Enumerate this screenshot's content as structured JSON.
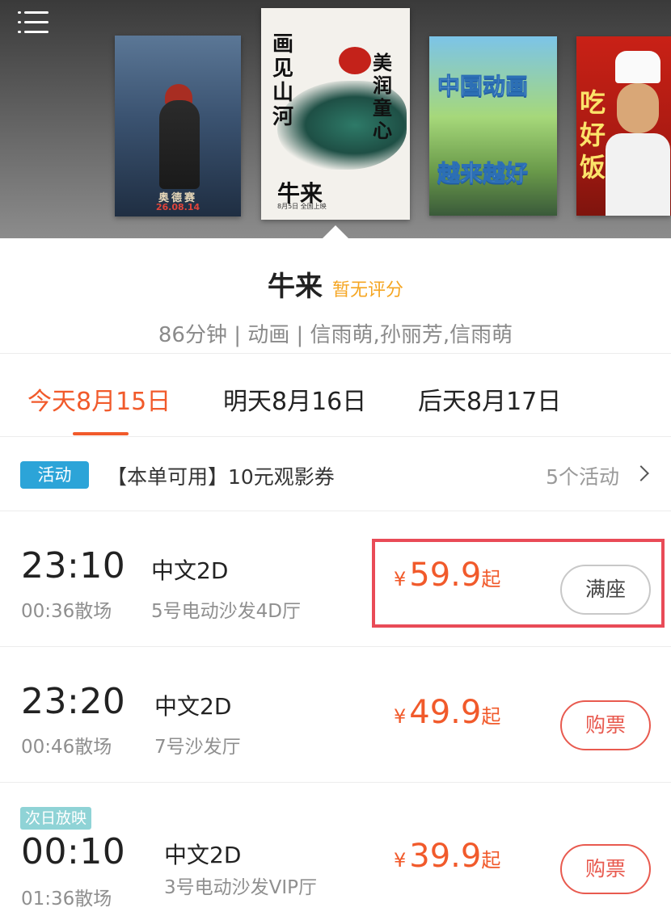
{
  "posters": [
    {
      "title": "奥德赛",
      "date": "26.08.14"
    },
    {
      "title_left": "画见山河",
      "title_right": "美润童心",
      "title_bottom": "牛来",
      "date": "8月5日 全国上映"
    },
    {
      "title_top": "中国动画",
      "title_bottom": "越来越好"
    },
    {
      "title": "吃好饭"
    }
  ],
  "movie": {
    "title": "牛来",
    "rating": "暂无评分",
    "meta": "86分钟 | 动画 | 信雨萌,孙丽芳,信雨萌"
  },
  "tabs": [
    {
      "label": "今天8月15日",
      "active": true
    },
    {
      "label": "明天8月16日",
      "active": false
    },
    {
      "label": "后天8月17日",
      "active": false
    }
  ],
  "promo": {
    "badge": "活动",
    "text": "【本单可用】10元观影券",
    "count": "5个活动"
  },
  "showtimes": [
    {
      "time": "23:10",
      "end": "00:36散场",
      "lang": "中文2D",
      "hall": "5号电动沙发4D厅",
      "currency": "¥",
      "price": "59.9",
      "suffix": "起",
      "button": "满座",
      "status": "full"
    },
    {
      "time": "23:20",
      "end": "00:46散场",
      "lang": "中文2D",
      "hall": "7号沙发厅",
      "currency": "¥",
      "price": "49.9",
      "suffix": "起",
      "button": "购票",
      "status": "available"
    },
    {
      "badge": "次日放映",
      "time": "00:10",
      "end": "01:36散场",
      "lang": "中文2D",
      "hall": "3号电动沙发VIP厅",
      "currency": "¥",
      "price": "39.9",
      "suffix": "起",
      "button": "购票",
      "status": "available"
    }
  ],
  "colors": {
    "accent": "#f15a2b",
    "badge_blue": "#2ca4d8",
    "rating": "#f5a623",
    "highlight": "#e94b57"
  }
}
